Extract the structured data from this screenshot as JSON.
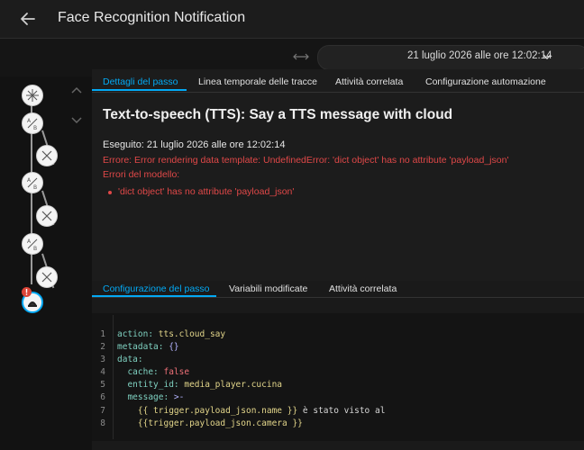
{
  "header": {
    "title": "Face Recognition Notification"
  },
  "date": {
    "label": "21 luglio 2026 alle ore 12:02:14"
  },
  "tabs": [
    {
      "label": "Dettagli del passo"
    },
    {
      "label": "Linea temporale delle tracce"
    },
    {
      "label": "Attività correlata"
    },
    {
      "label": "Configurazione automazione"
    }
  ],
  "step": {
    "title": "Text-to-speech (TTS): Say a TTS message with cloud",
    "executed": "Eseguito: 21 luglio 2026 alle ore 12:02:14",
    "error": "Errore: Error rendering data template: UndefinedError: 'dict object' has no attribute 'payload_json'",
    "template_errors_heading": "Errori del modello:",
    "template_errors": [
      "'dict object' has no attribute 'payload_json'"
    ]
  },
  "lower_tabs": [
    {
      "label": "Configurazione del passo"
    },
    {
      "label": "Variabili modificate"
    },
    {
      "label": "Attività correlata"
    }
  ],
  "code": {
    "line_numbers": [
      "1",
      "2",
      "3",
      "4",
      "5",
      "6",
      "7",
      "8"
    ],
    "l1_key": "action:",
    "l1_val": " tts.cloud_say",
    "l2_key": "metadata:",
    "l2_val": " {}",
    "l3_key": "data:",
    "l4_key": "  cache:",
    "l4_val": " false",
    "l5_key": "  entity_id:",
    "l5_val": " media_player.cucina",
    "l6_key": "  message:",
    "l6_val": " >-",
    "l7_a": "    {{ trigger.payload_json.name }}",
    "l7_b": " è stato visto al",
    "l8_a": "    {{trigger.payload_json.camera }}"
  },
  "colors": {
    "accent": "#03a9f4",
    "error": "#e04848",
    "background": "#1c1c1c"
  }
}
